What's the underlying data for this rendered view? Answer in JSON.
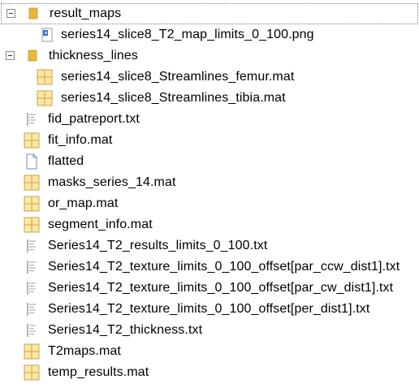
{
  "tree": {
    "rows": [
      {
        "label": "result_maps",
        "icon": "folder-icon",
        "expanded": true,
        "selected": true
      },
      {
        "label": "series14_slice8_T2_map_limits_0_100.png",
        "icon": "image-file-icon"
      },
      {
        "label": "thickness_lines",
        "icon": "folder-icon",
        "expanded": true
      },
      {
        "label": "series14_slice8_Streamlines_femur.mat",
        "icon": "mat-file-icon"
      },
      {
        "label": "series14_slice8_Streamlines_tibia.mat",
        "icon": "mat-file-icon"
      },
      {
        "label": "fid_patreport.txt",
        "icon": "text-file-icon"
      },
      {
        "label": "fit_info.mat",
        "icon": "mat-file-icon"
      },
      {
        "label": "flatted",
        "icon": "blank-file-icon"
      },
      {
        "label": "masks_series_14.mat",
        "icon": "mat-file-icon"
      },
      {
        "label": "or_map.mat",
        "icon": "mat-file-icon"
      },
      {
        "label": "segment_info.mat",
        "icon": "mat-file-icon"
      },
      {
        "label": "Series14_T2_results_limits_0_100.txt",
        "icon": "text-file-icon"
      },
      {
        "label": "Series14_T2_texture_limits_0_100_offset[par_ccw_dist1].txt",
        "icon": "text-file-icon"
      },
      {
        "label": "Series14_T2_texture_limits_0_100_offset[par_cw_dist1].txt",
        "icon": "text-file-icon"
      },
      {
        "label": "Series14_T2_texture_limits_0_100_offset[per_dist1].txt",
        "icon": "text-file-icon"
      },
      {
        "label": "Series14_T2_thickness.txt",
        "icon": "text-file-icon"
      },
      {
        "label": "T2maps.mat",
        "icon": "mat-file-icon"
      },
      {
        "label": "temp_results.mat",
        "icon": "mat-file-icon"
      }
    ]
  },
  "colors": {
    "folder": "#e8b83a",
    "mat_border": "#c7a64a",
    "mat_fill": "#fde7a4",
    "image_blue": "#2f6fd6"
  }
}
